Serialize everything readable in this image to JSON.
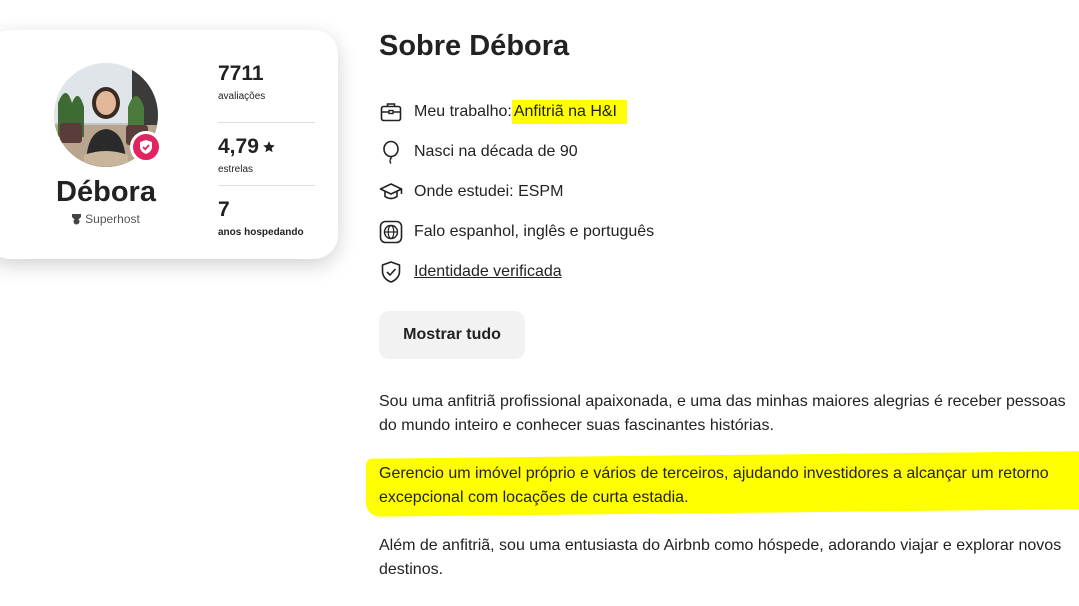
{
  "profile": {
    "name": "Débora",
    "superhost_label": "Superhost",
    "stats": [
      {
        "value": "7711",
        "label": "avaliações",
        "icon": ""
      },
      {
        "value": "4,79",
        "label": "estrelas",
        "icon": "star-icon"
      },
      {
        "value": "7",
        "label": "anos hospedando",
        "icon": ""
      }
    ]
  },
  "about": {
    "title": "Sobre Débora",
    "facts": [
      {
        "icon": "briefcase-icon",
        "prefix": "Meu trabalho: ",
        "value": "Anfitriã na H&I",
        "highlighted": true
      },
      {
        "icon": "balloon-icon",
        "text": "Nasci na década de 90"
      },
      {
        "icon": "graduation-cap-icon",
        "text": "Onde estudei: ESPM"
      },
      {
        "icon": "globe-icon",
        "text": "Falo espanhol, inglês e português"
      },
      {
        "icon": "shield-check-icon",
        "text": "Identidade verificada",
        "link": true
      }
    ],
    "show_all_label": "Mostrar tudo",
    "bio": [
      "Sou uma anfitriã profissional apaixonada, e uma das minhas maiores alegrias é receber pessoas do mundo inteiro e conhecer suas fascinantes histórias.",
      "Gerencio um imóvel próprio e vários de terceiros, ajudando investidores a alcançar um retorno excepcional com locações de curta estadia.",
      "Além de anfitriã, sou uma entusiasta do Airbnb como hóspede, adorando viajar e explorar novos destinos."
    ]
  },
  "colors": {
    "accent": "#e0245e",
    "highlight": "#ffff00",
    "text": "#222222",
    "button_bg": "#f2f2f2"
  }
}
